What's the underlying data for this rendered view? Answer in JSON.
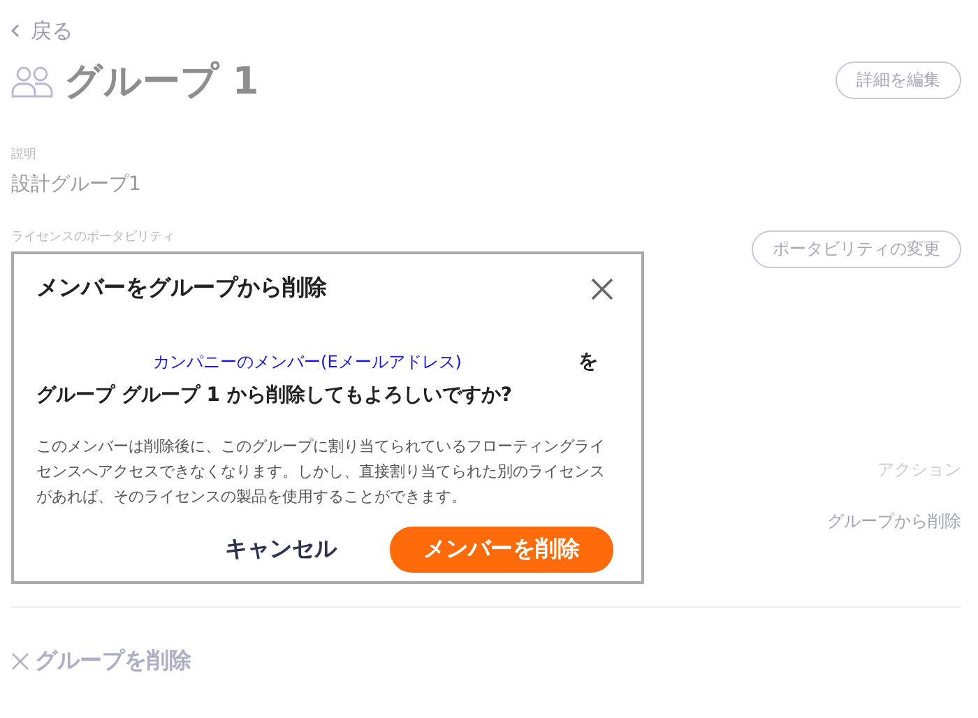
{
  "page": {
    "back_link": "戻る",
    "title": "グループ 1",
    "edit_button": "詳細を編集",
    "description_label": "説明",
    "description_value": "設計グループ1",
    "license_label": "ライセンスのポータビリティ",
    "portability_button": "ポータビリティの変更",
    "actions_header": "アクション",
    "remove_link": "グループから削除",
    "delete_group": "グループを削除"
  },
  "dialog": {
    "title": "メンバーをグループから削除",
    "member_link": "カンパニーのメンバー(Eメールアドレス)",
    "question": "をグループ グループ 1 から削除してもよろしいですか?",
    "body": "このメンバーは削除後に、このグループに割り当てられているフローティングライセンスへアクセスできなくなります。しかし、直接割り当てられた別のライセンスがあれば、そのライセンスの製品を使用することができます。",
    "cancel_button": "キャンセル",
    "confirm_button": "メンバーを削除"
  }
}
